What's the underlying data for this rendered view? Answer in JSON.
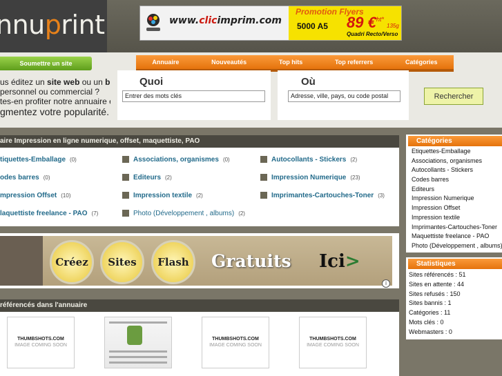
{
  "logo": {
    "text_before": "nnu",
    "text_p": "p",
    "text_after": "rint"
  },
  "banner_ad": {
    "site_pre": "www.",
    "site_red": "clic",
    "site_post": "imprim.com",
    "promo_title": "Promotion Flyers",
    "promo_qty": "5000 A5",
    "promo_price": "89 €",
    "promo_ht": "ht*",
    "promo_weight": "135g",
    "promo_quadri": "Quadri Recto/Verso"
  },
  "submit_button": "Soumettre un site",
  "promo_text": {
    "line1_pre": "us éditez un ",
    "line1_b1": "site web",
    "line1_mid": " ou un ",
    "line1_b2": "blog",
    "line1_post": ",",
    "line2": "personnel ou commercial ?",
    "line3": "tes-en profiter notre annuaire et",
    "line4": "gmentez votre popularité."
  },
  "nav": [
    "Annuaire",
    "Nouveautés",
    "Top hits",
    "Top referrers",
    "Catégories"
  ],
  "search": {
    "what_title": "Quoi",
    "what_value": "Entrer des mots clés",
    "where_title": "Où",
    "where_value": "Adresse, ville, pays, ou code postal",
    "button": "Rechercher"
  },
  "categories_box": {
    "title": "aire Impression en ligne numerique, offset, maquettiste, PAO",
    "items": [
      {
        "name": "tiquettes-Emballage",
        "count": "(0)"
      },
      {
        "name": "Associations, organismes",
        "count": "(0)"
      },
      {
        "name": "Autocollants - Stickers",
        "count": "(2)"
      },
      {
        "name": "odes barres",
        "count": "(0)"
      },
      {
        "name": "Editeurs",
        "count": "(2)"
      },
      {
        "name": "Impression Numerique",
        "count": "(23)"
      },
      {
        "name": "mpression Offset",
        "count": "(10)"
      },
      {
        "name": "Impression textile",
        "count": "(2)"
      },
      {
        "name": "Imprimantes-Cartouches-Toner",
        "count": "(3)"
      },
      {
        "name": "laquettiste freelance - PAO",
        "count": "(7)"
      },
      {
        "name": "Photo (Développement , albums)",
        "count": "(2)"
      }
    ]
  },
  "ad_banner": {
    "word1": "Créez",
    "word2": "Sites",
    "word3": "Flash",
    "word4": "Gratuits",
    "ici": "Ici",
    "arrow": ">",
    "info": "i"
  },
  "refs_box": {
    "title": "référencés dans l'annuaire",
    "thumbs": [
      {
        "type": "placeholder",
        "brand": "THUMBSHOTS.COM",
        "caption": "IMAGE COMING SOON"
      },
      {
        "type": "site"
      },
      {
        "type": "placeholder",
        "brand": "THUMBSHOTS.COM",
        "caption": "IMAGE COMING SOON"
      },
      {
        "type": "placeholder",
        "brand": "THUMBSHOTS.COM",
        "caption": "IMAGE COMING SOON"
      }
    ]
  },
  "sidebar_categories": {
    "title": "Catégories",
    "items": [
      "Etiquettes-Emballage",
      "Associations, organismes",
      "Autocollants - Stickers",
      "Codes barres",
      "Editeurs",
      "Impression Numerique",
      "Impression Offset",
      "Impression textile",
      "Imprimantes-Cartouches-Toner",
      "Maquettiste freelance - PAO",
      "Photo (Développement , albums)"
    ]
  },
  "statistics": {
    "title": "Statistiques",
    "items": [
      "Sites référencés : 51",
      "Sites en attente : 44",
      "Sites refusés : 150",
      "Sites bannis : 1",
      "Catégories : 11",
      "Mots clés : 0",
      "Webmasters : 0"
    ]
  },
  "colors": {
    "accent": "#f28a24",
    "green_button": "#7cbf32",
    "link": "#226a8a",
    "dark": "#4a4840"
  }
}
